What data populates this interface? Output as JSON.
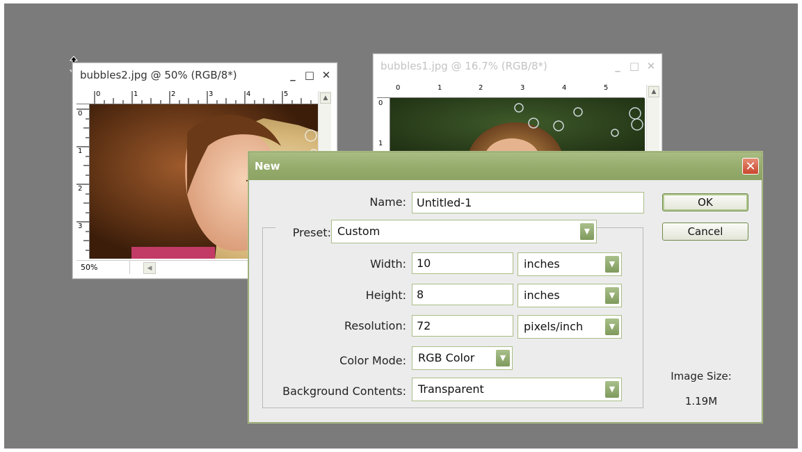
{
  "doc_windows": {
    "win1": {
      "title": "bubbles2.jpg @ 50% (RGB/8*)",
      "zoom": "50%",
      "ruler_top": [
        "0",
        "1",
        "2",
        "3",
        "4",
        "5"
      ],
      "ruler_left": [
        "0",
        "1",
        "2",
        "3"
      ]
    },
    "win2": {
      "title": "bubbles1.jpg @ 16.7% (RGB/8*)",
      "ruler_top": [
        "0",
        "1",
        "2",
        "3",
        "4",
        "5"
      ],
      "ruler_left": [
        "0",
        "1"
      ]
    }
  },
  "window_buttons": {
    "minimize": "_",
    "maximize": "□",
    "close": "✕"
  },
  "dialog": {
    "title": "New",
    "close_glyph": "✕",
    "name_label": "Name:",
    "name_value": "Untitled-1",
    "preset_label": "Preset:",
    "preset_value": "Custom",
    "width_label": "Width:",
    "width_value": "10",
    "width_unit": "inches",
    "height_label": "Height:",
    "height_value": "8",
    "height_unit": "inches",
    "resolution_label": "Resolution:",
    "resolution_value": "72",
    "resolution_unit": "pixels/inch",
    "color_mode_label": "Color Mode:",
    "color_mode_value": "RGB Color",
    "background_label": "Background Contents:",
    "background_value": "Transparent",
    "ok_label": "OK",
    "cancel_label": "Cancel",
    "image_size_label": "Image Size:",
    "image_size_value": "1.19M"
  },
  "colors": {
    "workspace": "#7b7b7b",
    "dialog_title": "#94aa6b",
    "field_border": "#a8bd86"
  }
}
